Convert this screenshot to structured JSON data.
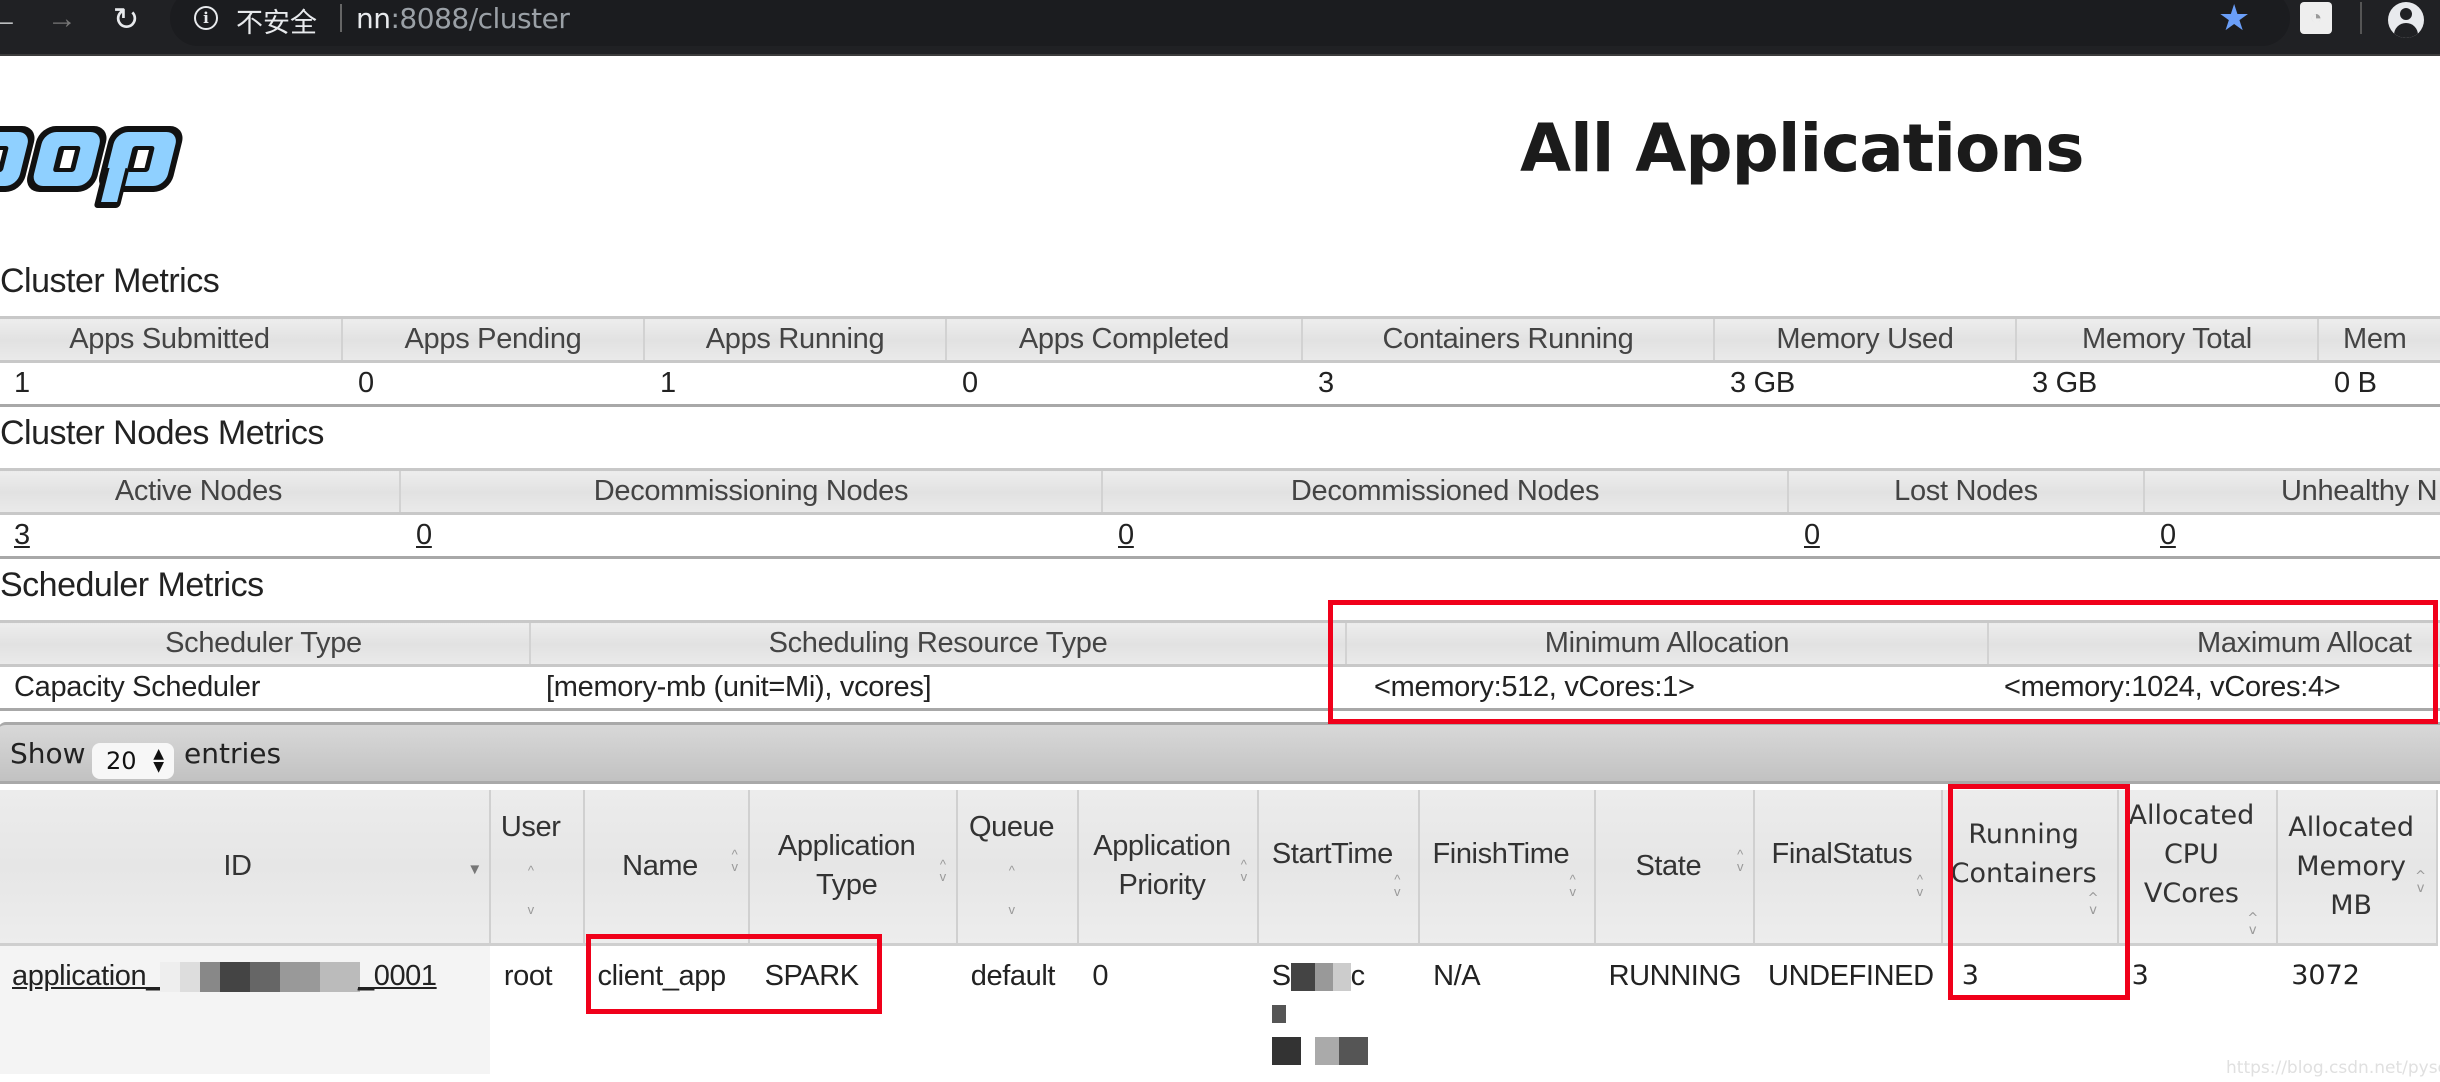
{
  "browser": {
    "security_label": "不安全",
    "url_host": "nn",
    "url_rest": ":8088/cluster",
    "icons": {
      "back": "back-arrow-icon",
      "forward": "forward-arrow-icon",
      "reload": "reload-icon",
      "info": "info-icon",
      "bookmark": "star-icon",
      "extension": "speedometer-icon",
      "profile": "profile-icon"
    },
    "bookmark_color": "#6a9ef8"
  },
  "header": {
    "logo_text": "oop",
    "title": "All Applications"
  },
  "cluster_metrics": {
    "title": "Cluster Metrics",
    "headers": [
      "Apps Submitted",
      "Apps Pending",
      "Apps Running",
      "Apps Completed",
      "Containers Running",
      "Memory Used",
      "Memory Total",
      "Mem"
    ],
    "values": [
      "1",
      "0",
      "1",
      "0",
      "3",
      "3 GB",
      "3 GB",
      "0 B"
    ]
  },
  "cluster_nodes_metrics": {
    "title": "Cluster Nodes Metrics",
    "headers": [
      "Active Nodes",
      "Decommissioning Nodes",
      "Decommissioned Nodes",
      "Lost Nodes",
      "Unhealthy N"
    ],
    "values": [
      "3",
      "0",
      "0",
      "0",
      "0"
    ]
  },
  "scheduler_metrics": {
    "title": "Scheduler Metrics",
    "headers": [
      "Scheduler Type",
      "Scheduling Resource Type",
      "Minimum Allocation",
      "Maximum Allocat"
    ],
    "values": [
      "Capacity Scheduler",
      "[memory-mb (unit=Mi), vcores]",
      "<memory:512, vCores:1>",
      "<memory:1024, vCores:4>"
    ]
  },
  "apps_table": {
    "show_label": "Show",
    "page_length": "20",
    "entries_label": "entries",
    "columns": [
      {
        "line1": "ID",
        "line2": "",
        "line3": "",
        "sort": "desc"
      },
      {
        "line1": "User",
        "line2": "",
        "line3": "",
        "sort": "both"
      },
      {
        "line1": "Name",
        "line2": "",
        "line3": "",
        "sort": "both"
      },
      {
        "line1": "Application",
        "line2": "Type",
        "line3": "",
        "sort": "both"
      },
      {
        "line1": "Queue",
        "line2": "",
        "line3": "",
        "sort": "both"
      },
      {
        "line1": "Application",
        "line2": "Priority",
        "line3": "",
        "sort": "both"
      },
      {
        "line1": "StartTime",
        "line2": "",
        "line3": "",
        "sort": "both"
      },
      {
        "line1": "FinishTime",
        "line2": "",
        "line3": "",
        "sort": "both"
      },
      {
        "line1": "State",
        "line2": "",
        "line3": "",
        "sort": "both"
      },
      {
        "line1": "FinalStatus",
        "line2": "",
        "line3": "",
        "sort": "both"
      },
      {
        "line1": "Running",
        "line2": "Containers",
        "line3": "",
        "sort": "both"
      },
      {
        "line1": "Allocated",
        "line2": "CPU",
        "line3": "VCores",
        "sort": "both"
      },
      {
        "line1": "Allocated",
        "line2": "Memory",
        "line3": "MB",
        "sort": "both"
      }
    ],
    "rows": [
      {
        "id_prefix": "application_",
        "id_suffix": "_0001",
        "user": "root",
        "name": "client_app",
        "type": "SPARK",
        "queue": "default",
        "priority": "0",
        "start_time_visible": "S c",
        "finish_time": "N/A",
        "state": "RUNNING",
        "final_status": "UNDEFINED",
        "running_containers": "3",
        "allocated_vcores": "3",
        "allocated_memory_mb": "3072"
      }
    ]
  },
  "annotations": {
    "highlight_color": "#f0001a"
  },
  "watermark": "https://blog.csdn.net/pysense"
}
